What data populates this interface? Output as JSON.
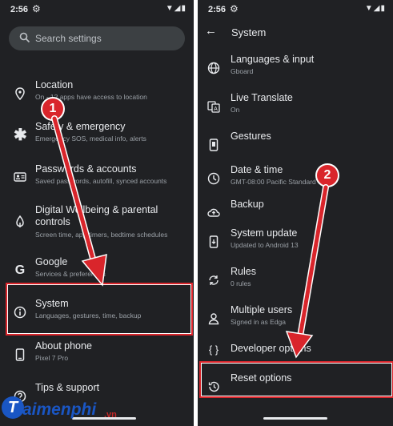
{
  "left": {
    "status": {
      "time": "2:56",
      "icons": "▼◢▮"
    },
    "search": {
      "placeholder": "Search settings"
    },
    "items": [
      {
        "title": "Location",
        "subtitle": "On - 12 apps have access to location",
        "icon": "location-pin-icon"
      },
      {
        "title": "Safety & emergency",
        "subtitle": "Emergency SOS, medical info, alerts",
        "icon": "asterisk-icon"
      },
      {
        "title": "Passwords & accounts",
        "subtitle": "Saved passwords, autofill, synced accounts",
        "icon": "account-card-icon"
      },
      {
        "title": "Digital Wellbeing & parental",
        "title2": "controls",
        "subtitle": "Screen time, app timers, bedtime schedules",
        "icon": "wellbeing-icon"
      },
      {
        "title": "Google",
        "subtitle": "Services & preferences",
        "icon": "google-g-icon"
      },
      {
        "title": "System",
        "subtitle": "Languages, gestures, time, backup",
        "icon": "info-icon"
      },
      {
        "title": "About phone",
        "subtitle": "Pixel 7 Pro",
        "icon": "phone-icon"
      },
      {
        "title": "Tips & support",
        "subtitle": "",
        "icon": "help-icon"
      }
    ],
    "marker": "1"
  },
  "right": {
    "status": {
      "time": "2:56",
      "icons": "▼◢▮"
    },
    "appbar": {
      "title": "System"
    },
    "items": [
      {
        "title": "Languages & input",
        "subtitle": "Gboard",
        "icon": "globe-icon"
      },
      {
        "title": "Live Translate",
        "subtitle": "On",
        "icon": "translate-icon"
      },
      {
        "title": "Gestures",
        "subtitle": "",
        "icon": "gestures-phone-icon"
      },
      {
        "title": "Date & time",
        "subtitle": "GMT-08:00 Pacific Standard",
        "icon": "clock-icon"
      },
      {
        "title": "Backup",
        "subtitle": "",
        "icon": "cloud-backup-icon"
      },
      {
        "title": "System update",
        "subtitle": "Updated to Android 13",
        "icon": "system-update-icon"
      },
      {
        "title": "Rules",
        "subtitle": "0 rules",
        "icon": "rules-icon"
      },
      {
        "title": "Multiple users",
        "subtitle": "Signed in as Edga",
        "icon": "user-icon"
      },
      {
        "title": "Developer options",
        "subtitle": "",
        "icon": "code-braces-icon"
      },
      {
        "title": "Reset options",
        "subtitle": "",
        "icon": "history-icon"
      }
    ],
    "marker": "2"
  },
  "watermark": {
    "brand": "aimenphi",
    "suffix": ".vn",
    "initial": "T"
  },
  "colors": {
    "background": "#202124",
    "text": "#e8eaed",
    "subtext": "#9aa0a6",
    "highlight": "#d9252b",
    "logo_blue": "#1a56c4"
  }
}
